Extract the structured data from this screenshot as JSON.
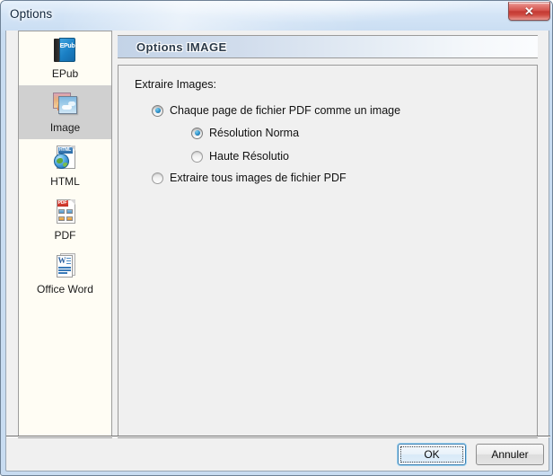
{
  "window": {
    "title": "Options",
    "close_label": "✕",
    "close_icon": "close-icon"
  },
  "sidebar": {
    "items": [
      {
        "label": "EPub",
        "icon": "epub-book-icon",
        "selected": false
      },
      {
        "label": "Image",
        "icon": "photos-icon",
        "selected": true
      },
      {
        "label": "HTML",
        "icon": "html-globe-icon",
        "selected": false
      },
      {
        "label": "PDF",
        "icon": "pdf-file-icon",
        "selected": false
      },
      {
        "label": "Office Word",
        "icon": "word-file-icon",
        "selected": false
      }
    ]
  },
  "panel": {
    "header_title": "Options IMAGE",
    "group_label": "Extraire Images:",
    "options": [
      {
        "label": "Chaque page de fichier PDF  comme un image",
        "checked": true,
        "level": 0
      },
      {
        "label": "Résolution Norma",
        "checked": true,
        "level": 1
      },
      {
        "label": "Haute Résolutio",
        "checked": false,
        "level": 1
      },
      {
        "label": "Extraire tous images de fichier PDF",
        "checked": false,
        "level": 0
      }
    ]
  },
  "footer": {
    "ok_label": "OK",
    "cancel_label": "Annuler"
  },
  "colors": {
    "accent_blue": "#2b8fc9",
    "close_red": "#c33a33",
    "selection_gray": "#d0d0d0",
    "sidebar_bg": "#fffdf4",
    "panel_bg": "#f0f0f0"
  }
}
